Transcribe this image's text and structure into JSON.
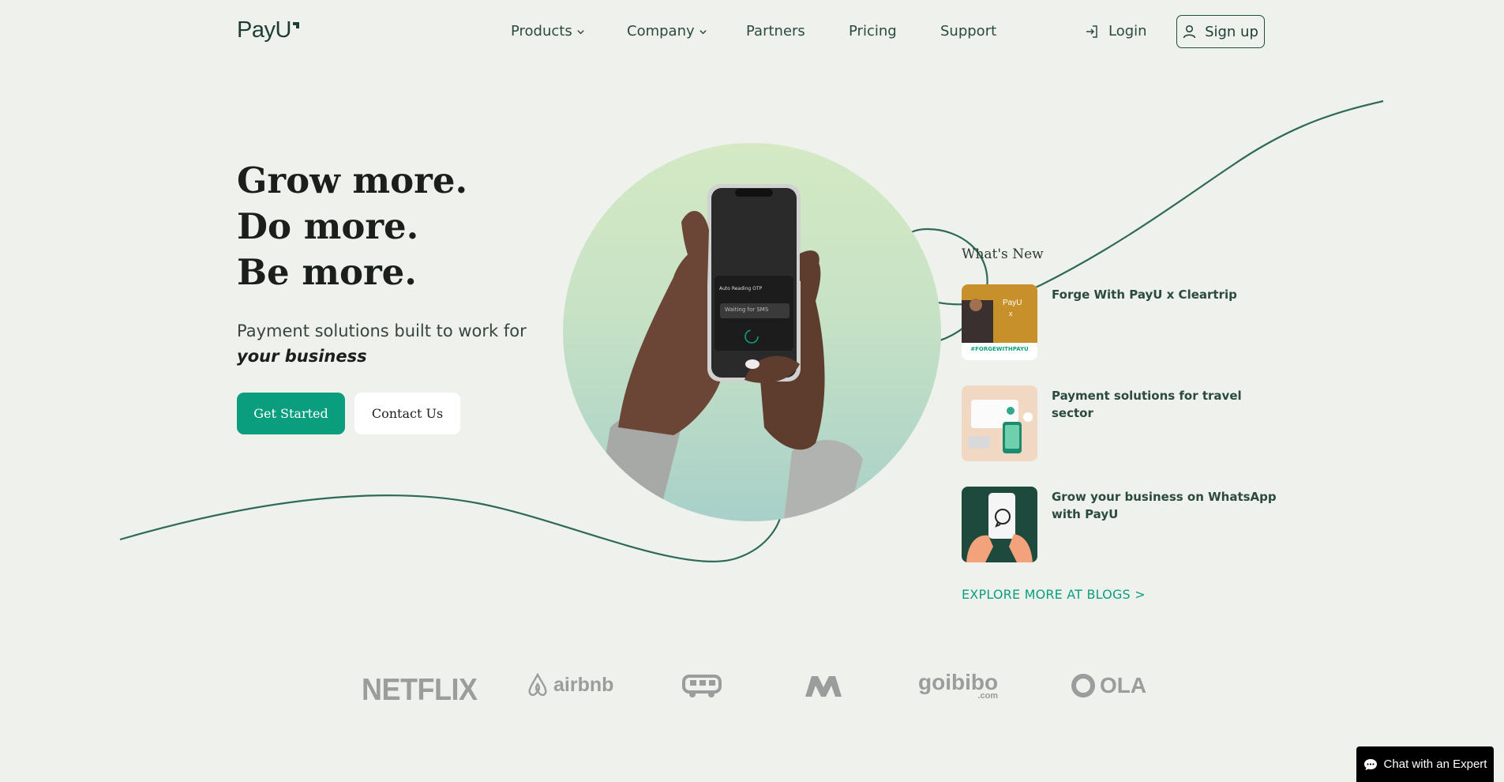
{
  "brand": {
    "logo_text": "PayU"
  },
  "nav": {
    "items": [
      {
        "label": "Products"
      },
      {
        "label": "Company"
      },
      {
        "label": "Partners"
      },
      {
        "label": "Pricing"
      },
      {
        "label": "Support"
      }
    ],
    "login_label": "Login",
    "signup_label": "Sign up"
  },
  "hero": {
    "headline": [
      "Grow more.",
      "Do more.",
      "Be more."
    ],
    "subtext_prefix": "Payment solutions built to work for ",
    "subtext_emphasis": "your business",
    "primary_cta": "Get Started",
    "secondary_cta": "Contact Us",
    "phone": {
      "title": "Auto Reading OTP",
      "field": "Waiting for SMS"
    }
  },
  "whats_new": {
    "title": "What's New",
    "items": [
      {
        "title": "Forge With PayU x Cleartrip",
        "thumb_caption": "#FORGEWITHPAYU",
        "thumb_logo": "PayU",
        "thumb_x": "x"
      },
      {
        "title": "Payment solutions for travel sector"
      },
      {
        "title": "Grow your business on WhatsApp with PayU"
      }
    ],
    "explore_label": "EXPLORE MORE AT BLOGS >"
  },
  "clients": {
    "netflix": "NETFLIX",
    "airbnb": "airbnb",
    "goibibo": "goibibo",
    "goibibo_sub": ".com",
    "ola": "OLA"
  },
  "chat": {
    "label": "Chat with an Expert"
  },
  "colors": {
    "accent": "#0a9e7e",
    "dark_green": "#1e4d40",
    "background": "#eef1ec"
  }
}
